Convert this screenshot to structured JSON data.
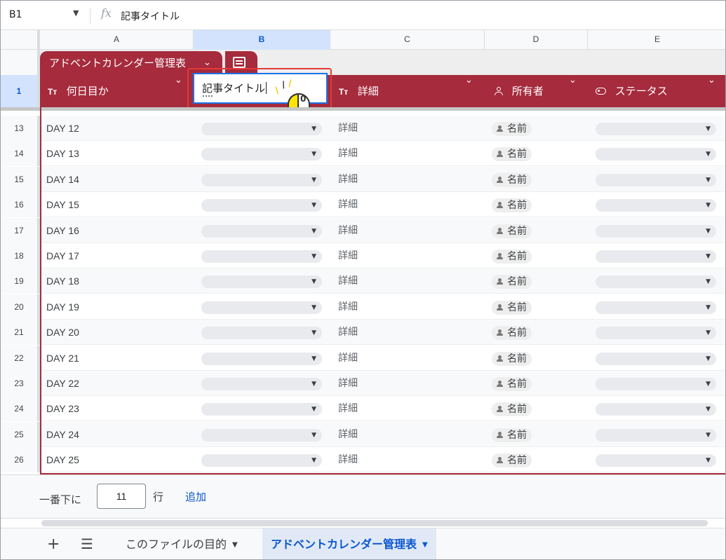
{
  "formula_bar": {
    "cell_ref": "B1",
    "fx_symbol": "fx",
    "content": "記事タイトル"
  },
  "column_headers": [
    "A",
    "B",
    "C",
    "D",
    "E"
  ],
  "selected_column": "B",
  "table_tab": {
    "name": "アドベントカレンダー管理表"
  },
  "header_row": {
    "row_number": "1",
    "columns": [
      {
        "icon": "Tт",
        "label": "何日目か"
      },
      {
        "icon": "",
        "label": ""
      },
      {
        "icon": "Tт",
        "label": "詳細"
      },
      {
        "icon": "person-icon",
        "label": "所有者"
      },
      {
        "icon": "chip-icon",
        "label": "ステータス"
      }
    ],
    "editing_value": "記事タイトル"
  },
  "rows": [
    {
      "num": "13",
      "day": "DAY 12",
      "detail": "詳細",
      "owner": "名前"
    },
    {
      "num": "14",
      "day": "DAY 13",
      "detail": "詳細",
      "owner": "名前"
    },
    {
      "num": "15",
      "day": "DAY 14",
      "detail": "詳細",
      "owner": "名前"
    },
    {
      "num": "16",
      "day": "DAY 15",
      "detail": "詳細",
      "owner": "名前"
    },
    {
      "num": "17",
      "day": "DAY 16",
      "detail": "詳細",
      "owner": "名前"
    },
    {
      "num": "18",
      "day": "DAY 17",
      "detail": "詳細",
      "owner": "名前"
    },
    {
      "num": "19",
      "day": "DAY 18",
      "detail": "詳細",
      "owner": "名前"
    },
    {
      "num": "20",
      "day": "DAY 19",
      "detail": "詳細",
      "owner": "名前"
    },
    {
      "num": "21",
      "day": "DAY 20",
      "detail": "詳細",
      "owner": "名前"
    },
    {
      "num": "22",
      "day": "DAY 21",
      "detail": "詳細",
      "owner": "名前"
    },
    {
      "num": "23",
      "day": "DAY 22",
      "detail": "詳細",
      "owner": "名前"
    },
    {
      "num": "24",
      "day": "DAY 23",
      "detail": "詳細",
      "owner": "名前"
    },
    {
      "num": "25",
      "day": "DAY 24",
      "detail": "詳細",
      "owner": "名前"
    },
    {
      "num": "26",
      "day": "DAY 25",
      "detail": "詳細",
      "owner": "名前"
    }
  ],
  "add_rows": {
    "prefix": "一番下に",
    "count": "11",
    "unit": "行",
    "button": "追加"
  },
  "sheet_tabs": [
    {
      "label": "このファイルの目的",
      "active": false
    },
    {
      "label": "アドベントカレンダー管理表",
      "active": true
    }
  ],
  "mouse_button_label": "0",
  "colors": {
    "table_header": "#a52b3d",
    "highlight_box": "#e53935",
    "selection_blue": "#1a73e8",
    "link_blue": "#0b57d0"
  }
}
